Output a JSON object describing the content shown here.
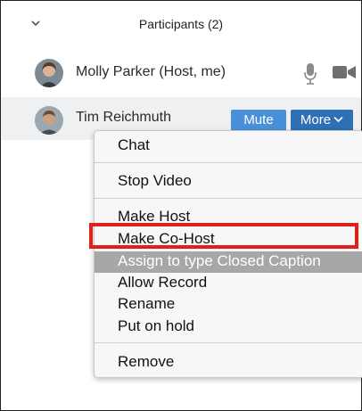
{
  "header": {
    "title": "Participants (2)",
    "chevron_icon": "chevron-down-icon"
  },
  "participants": [
    {
      "name": "Molly Parker (Host, me)",
      "mic_icon": "microphone-icon",
      "video_icon": "video-camera-icon"
    },
    {
      "name": "Tim Reichmuth",
      "mute_label": "Mute",
      "more_label": "More"
    }
  ],
  "menu": {
    "items": [
      "Chat",
      "Stop Video",
      "Make Host",
      "Make Co-Host",
      "Assign to type Closed Caption",
      "Allow Record",
      "Rename",
      "Put on hold",
      "Remove"
    ],
    "highlight_color": "#a7a7a7",
    "annotation_color": "#e0201b"
  },
  "colors": {
    "mute_button": "#4a90d9",
    "more_button": "#2f6fb5",
    "selected_row": "#eef0f2"
  }
}
